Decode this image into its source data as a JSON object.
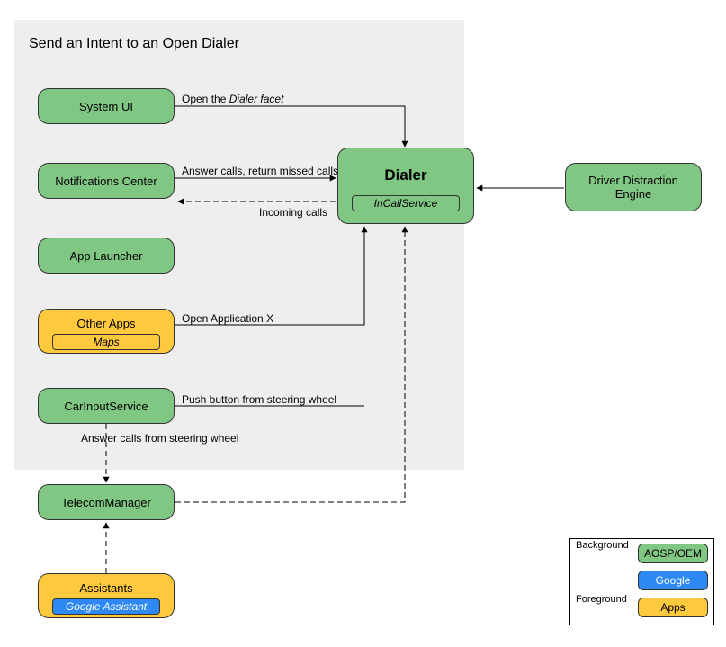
{
  "panel": {
    "title": "Send an Intent to an Open Dialer"
  },
  "boxes": {
    "system_ui": "System UI",
    "notifications": "Notifications Center",
    "app_launcher": "App Launcher",
    "other_apps": {
      "label": "Other Apps",
      "sub": "Maps"
    },
    "car_input": "CarInputService",
    "telecom": "TelecomManager",
    "assistants": {
      "label": "Assistants",
      "sub": "Google Assistant"
    },
    "dialer": {
      "label": "Dialer",
      "sub": "InCallService"
    },
    "dde": "Driver Distraction Engine"
  },
  "edges": {
    "open_dialer_facet_prefix": "Open the ",
    "open_dialer_facet_italic": "Dialer facet",
    "answer_return": "Answer calls, return missed calls",
    "incoming": "Incoming calls",
    "open_app_x": "Open Application X",
    "push_button": "Push button from steering wheel",
    "answer_wheel": "Answer calls from steering wheel"
  },
  "legend": {
    "background": "Background",
    "foreground": "Foreground",
    "aosp": "AOSP/OEM",
    "google": "Google",
    "apps": "Apps"
  },
  "colors": {
    "green": "#81c784",
    "amber": "#fec93c",
    "blue": "#2f89f4",
    "panel": "#eeeeee"
  }
}
